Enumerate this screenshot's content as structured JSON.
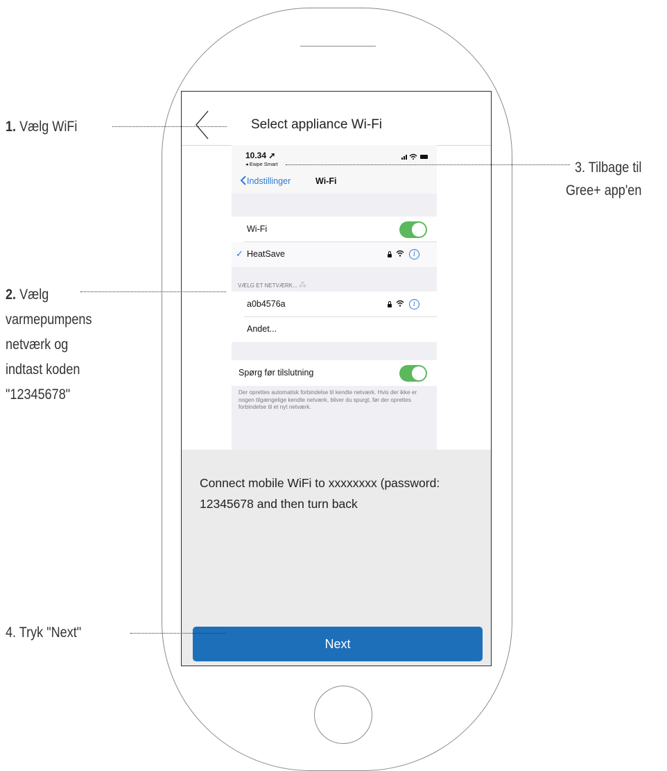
{
  "annotations": {
    "step1": {
      "num": "1.",
      "text": "Vælg WiFi"
    },
    "step2": {
      "num": "2.",
      "lines": [
        "Vælg",
        "varmepumpens",
        "netværk og",
        "indtast koden",
        "\"12345678\""
      ]
    },
    "step3": {
      "lines": [
        "3. Tilbage til",
        "Gree+ app'en"
      ]
    },
    "step4": {
      "text": "4. Tryk \"Next\""
    }
  },
  "app": {
    "title": "Select appliance Wi-Fi",
    "message": "Connect mobile WiFi to xxxxxxxx (password: 12345678 and then turn back",
    "next_label": "Next"
  },
  "ios": {
    "time": "10.34",
    "back_app": "◂ Ewpe Smart",
    "nav_back": "Indstillinger",
    "nav_title": "Wi-Fi",
    "wifi_label": "Wi-Fi",
    "wifi_on": true,
    "connected_network": "HeatSave",
    "section_header": "VÆLG ET NETVÆRK...",
    "networks": [
      "a0b4576a",
      "Andet..."
    ],
    "ask_label": "Spørg før tilslutning",
    "ask_on": true,
    "ask_description": "Der oprettes automatisk forbindelse til kendte netværk. Hvis der ikke er nogen tilgængelige kendte netværk, bliver du spurgt, før der oprettes forbindelse til et nyt netværk."
  },
  "colors": {
    "accent": "#1e6fba",
    "toggle_on": "#5cb85c",
    "ios_link": "#2d7bd6",
    "bottom_bg": "#ebebeb"
  }
}
